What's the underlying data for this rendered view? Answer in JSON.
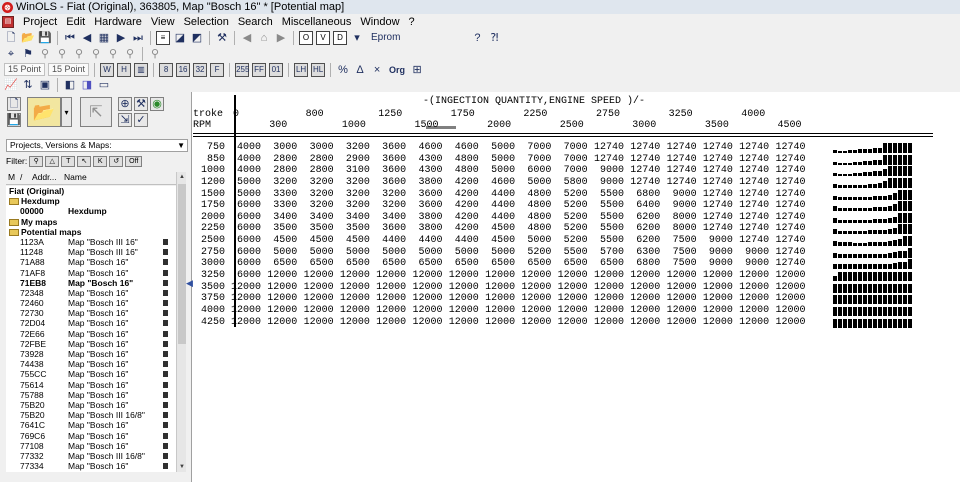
{
  "window": {
    "title": "WinOLS - Fiat (Original), 363805, Map \"Bosch 16\" *   [Potential map]"
  },
  "menu": [
    "Project",
    "Edit",
    "Hardware",
    "View",
    "Selection",
    "Search",
    "Miscellaneous",
    "Window",
    "?"
  ],
  "toolbar": {
    "eprom_label": "Eprom",
    "font1": "15 Point",
    "font2": "15 Point",
    "org_label": "Org"
  },
  "left": {
    "combo": "Projects, Versions & Maps:",
    "filter_label": "Filter:",
    "off_label": "Off",
    "columns": [
      "M",
      "/",
      "Addr...",
      "Name"
    ],
    "tree": [
      {
        "kind": "head",
        "text": "Fiat (Original)"
      },
      {
        "kind": "folder",
        "text": "Hexdump"
      },
      {
        "kind": "item",
        "addr": "00000",
        "name": "Hexdump",
        "bold": true
      },
      {
        "kind": "folder",
        "text": "My maps"
      },
      {
        "kind": "folder",
        "text": "Potential maps"
      },
      {
        "kind": "item",
        "addr": "1123A",
        "name": "Map \"Bosch III 16\""
      },
      {
        "kind": "item",
        "addr": "11248",
        "name": "Map \"Bosch III 16\""
      },
      {
        "kind": "item",
        "addr": "71A88",
        "name": "Map \"Bosch 16\""
      },
      {
        "kind": "item",
        "addr": "71AF8",
        "name": "Map \"Bosch 16\""
      },
      {
        "kind": "item",
        "addr": "71EB8",
        "name": "Map \"Bosch 16\"",
        "bold": true
      },
      {
        "kind": "item",
        "addr": "72348",
        "name": "Map \"Bosch 16\""
      },
      {
        "kind": "item",
        "addr": "72460",
        "name": "Map \"Bosch 16\""
      },
      {
        "kind": "item",
        "addr": "72730",
        "name": "Map \"Bosch 16\""
      },
      {
        "kind": "item",
        "addr": "72D04",
        "name": "Map \"Bosch 16\""
      },
      {
        "kind": "item",
        "addr": "72E66",
        "name": "Map \"Bosch 16\""
      },
      {
        "kind": "item",
        "addr": "72FBE",
        "name": "Map \"Bosch 16\""
      },
      {
        "kind": "item",
        "addr": "73928",
        "name": "Map \"Bosch 16\""
      },
      {
        "kind": "item",
        "addr": "74438",
        "name": "Map \"Bosch 16\""
      },
      {
        "kind": "item",
        "addr": "755CC",
        "name": "Map \"Bosch 16\""
      },
      {
        "kind": "item",
        "addr": "75614",
        "name": "Map \"Bosch 16\""
      },
      {
        "kind": "item",
        "addr": "75788",
        "name": "Map \"Bosch 16\""
      },
      {
        "kind": "item",
        "addr": "75B20",
        "name": "Map \"Bosch 16\""
      },
      {
        "kind": "item",
        "addr": "75B20",
        "name": "Map \"Bosch III 16/8\""
      },
      {
        "kind": "item",
        "addr": "7641C",
        "name": "Map \"Bosch 16\""
      },
      {
        "kind": "item",
        "addr": "769C6",
        "name": "Map \"Bosch 16\""
      },
      {
        "kind": "item",
        "addr": "77108",
        "name": "Map \"Bosch 16\""
      },
      {
        "kind": "item",
        "addr": "77332",
        "name": "Map \"Bosch III 16/8\""
      },
      {
        "kind": "item",
        "addr": "77334",
        "name": "Map \"Bosch 16\""
      }
    ]
  },
  "map": {
    "title": "-(INGECTION QUANTITY,ENGINE SPEED )/-",
    "row_label_1": "troke",
    "row_label_2": "RPM",
    "x_top": [
      "0",
      "800",
      "1250",
      "1750",
      "2250",
      "2750",
      "3250",
      "4000"
    ],
    "x_bottom": [
      "300",
      "1000",
      "1500",
      "2000",
      "2500",
      "3000",
      "3500",
      "4500"
    ],
    "rows": [
      {
        "rpm": "750",
        "vals": [
          "4000",
          "3000",
          "3000",
          "3200",
          "3600",
          "4600",
          "4600",
          "5000",
          "7000",
          "7000",
          "12740",
          "12740",
          "12740",
          "12740",
          "12740",
          "12740"
        ]
      },
      {
        "rpm": "850",
        "vals": [
          "4000",
          "2800",
          "2800",
          "2900",
          "3600",
          "4300",
          "4800",
          "5000",
          "7000",
          "7000",
          "12740",
          "12740",
          "12740",
          "12740",
          "12740",
          "12740"
        ]
      },
      {
        "rpm": "1000",
        "vals": [
          "4000",
          "2800",
          "2800",
          "3100",
          "3600",
          "4300",
          "4800",
          "5000",
          "6000",
          "7000",
          "9000",
          "12740",
          "12740",
          "12740",
          "12740",
          "12740"
        ]
      },
      {
        "rpm": "1200",
        "vals": [
          "5000",
          "3200",
          "3200",
          "3200",
          "3600",
          "3800",
          "4200",
          "4600",
          "5000",
          "5800",
          "9000",
          "12740",
          "12740",
          "12740",
          "12740",
          "12740"
        ]
      },
      {
        "rpm": "1500",
        "vals": [
          "5000",
          "3300",
          "3200",
          "3200",
          "3200",
          "3600",
          "4200",
          "4400",
          "4800",
          "5200",
          "5500",
          "6800",
          "9000",
          "12740",
          "12740",
          "12740"
        ]
      },
      {
        "rpm": "1750",
        "vals": [
          "6000",
          "3300",
          "3200",
          "3200",
          "3200",
          "3600",
          "4200",
          "4400",
          "4800",
          "5200",
          "5500",
          "6400",
          "9000",
          "12740",
          "12740",
          "12740"
        ]
      },
      {
        "rpm": "2000",
        "vals": [
          "6000",
          "3400",
          "3400",
          "3400",
          "3400",
          "3800",
          "4200",
          "4400",
          "4800",
          "5200",
          "5500",
          "6200",
          "8000",
          "12740",
          "12740",
          "12740"
        ]
      },
      {
        "rpm": "2250",
        "vals": [
          "6000",
          "3500",
          "3500",
          "3500",
          "3600",
          "3800",
          "4200",
          "4500",
          "4800",
          "5200",
          "5500",
          "6200",
          "8000",
          "12740",
          "12740",
          "12740"
        ]
      },
      {
        "rpm": "2500",
        "vals": [
          "6000",
          "4500",
          "4500",
          "4500",
          "4400",
          "4400",
          "4400",
          "4500",
          "5000",
          "5200",
          "5500",
          "6200",
          "7500",
          "9000",
          "12740",
          "12740"
        ]
      },
      {
        "rpm": "2750",
        "vals": [
          "6000",
          "5000",
          "5000",
          "5000",
          "5000",
          "5000",
          "5000",
          "5000",
          "5200",
          "5500",
          "5700",
          "6300",
          "7500",
          "9000",
          "9000",
          "12740"
        ]
      },
      {
        "rpm": "3000",
        "vals": [
          "6000",
          "6500",
          "6500",
          "6500",
          "6500",
          "6500",
          "6500",
          "6500",
          "6500",
          "6500",
          "6500",
          "6800",
          "7500",
          "9000",
          "9000",
          "12740"
        ]
      },
      {
        "rpm": "3250",
        "vals": [
          "6000",
          "12000",
          "12000",
          "12000",
          "12000",
          "12000",
          "12000",
          "12000",
          "12000",
          "12000",
          "12000",
          "12000",
          "12000",
          "12000",
          "12000",
          "12000"
        ]
      },
      {
        "rpm": "3500",
        "vals": [
          "12000",
          "12000",
          "12000",
          "12000",
          "12000",
          "12000",
          "12000",
          "12000",
          "12000",
          "12000",
          "12000",
          "12000",
          "12000",
          "12000",
          "12000",
          "12000"
        ]
      },
      {
        "rpm": "3750",
        "vals": [
          "12000",
          "12000",
          "12000",
          "12000",
          "12000",
          "12000",
          "12000",
          "12000",
          "12000",
          "12000",
          "12000",
          "12000",
          "12000",
          "12000",
          "12000",
          "12000"
        ]
      },
      {
        "rpm": "4000",
        "vals": [
          "12000",
          "12000",
          "12000",
          "12000",
          "12000",
          "12000",
          "12000",
          "12000",
          "12000",
          "12000",
          "12000",
          "12000",
          "12000",
          "12000",
          "12000",
          "12000"
        ]
      },
      {
        "rpm": "4250",
        "vals": [
          "12000",
          "12000",
          "12000",
          "12000",
          "12000",
          "12000",
          "12000",
          "12000",
          "12000",
          "12000",
          "12000",
          "12000",
          "12000",
          "12000",
          "12000",
          "12000"
        ]
      }
    ]
  }
}
